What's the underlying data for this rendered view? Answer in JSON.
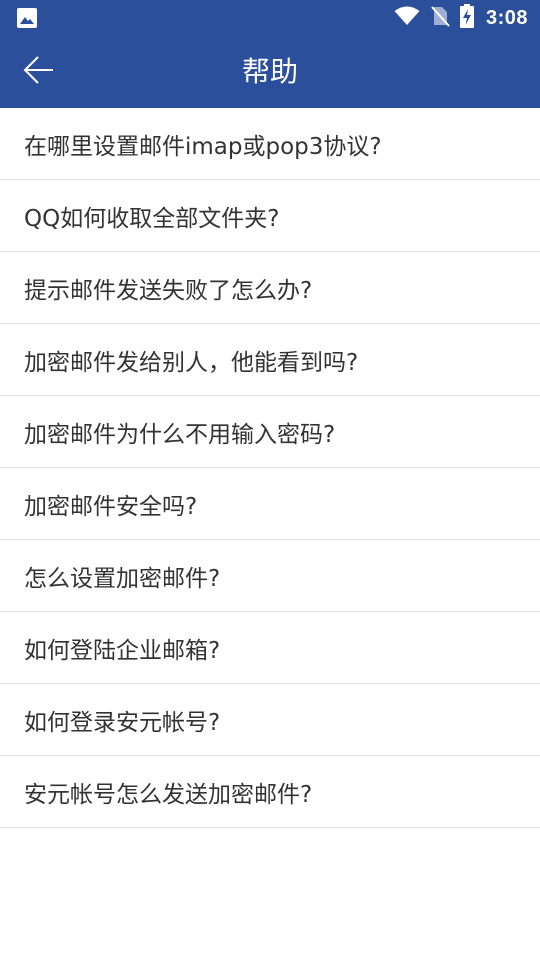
{
  "status_bar": {
    "time": "3:08",
    "icons": [
      "image-notification-icon",
      "wifi-icon",
      "no-sim-icon",
      "battery-charging-icon"
    ]
  },
  "app_bar": {
    "title": "帮助",
    "back_icon": "back-arrow-icon"
  },
  "colors": {
    "primary": "#2b4f9b",
    "divider": "#e3e3e3",
    "text": "#333333"
  },
  "faq": {
    "items": [
      {
        "label": "在哪里设置邮件imap或pop3协议?"
      },
      {
        "label": "QQ如何收取全部文件夹?"
      },
      {
        "label": "提示邮件发送失败了怎么办?"
      },
      {
        "label": "加密邮件发给别人，他能看到吗?"
      },
      {
        "label": "加密邮件为什么不用输入密码?"
      },
      {
        "label": "加密邮件安全吗?"
      },
      {
        "label": "怎么设置加密邮件?"
      },
      {
        "label": "如何登陆企业邮箱?"
      },
      {
        "label": "如何登录安元帐号?"
      },
      {
        "label": "安元帐号怎么发送加密邮件?"
      }
    ]
  }
}
